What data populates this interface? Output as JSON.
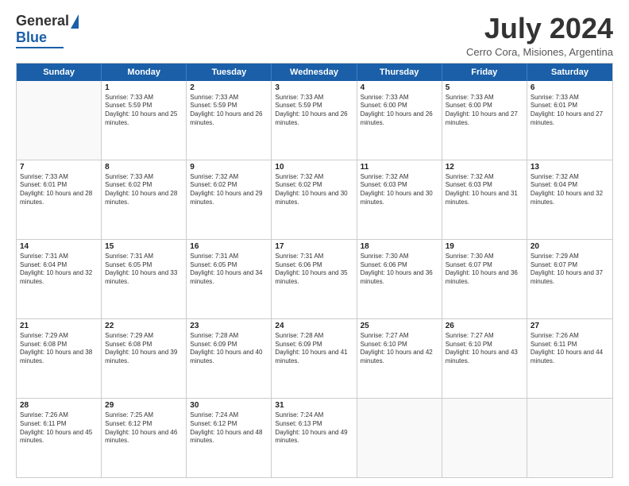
{
  "logo": {
    "general": "General",
    "blue": "Blue"
  },
  "title": "July 2024",
  "location": "Cerro Cora, Misiones, Argentina",
  "days_of_week": [
    "Sunday",
    "Monday",
    "Tuesday",
    "Wednesday",
    "Thursday",
    "Friday",
    "Saturday"
  ],
  "weeks": [
    [
      {
        "day": "",
        "sunrise": "",
        "sunset": "",
        "daylight": ""
      },
      {
        "day": "1",
        "sunrise": "Sunrise: 7:33 AM",
        "sunset": "Sunset: 5:59 PM",
        "daylight": "Daylight: 10 hours and 25 minutes."
      },
      {
        "day": "2",
        "sunrise": "Sunrise: 7:33 AM",
        "sunset": "Sunset: 5:59 PM",
        "daylight": "Daylight: 10 hours and 26 minutes."
      },
      {
        "day": "3",
        "sunrise": "Sunrise: 7:33 AM",
        "sunset": "Sunset: 5:59 PM",
        "daylight": "Daylight: 10 hours and 26 minutes."
      },
      {
        "day": "4",
        "sunrise": "Sunrise: 7:33 AM",
        "sunset": "Sunset: 6:00 PM",
        "daylight": "Daylight: 10 hours and 26 minutes."
      },
      {
        "day": "5",
        "sunrise": "Sunrise: 7:33 AM",
        "sunset": "Sunset: 6:00 PM",
        "daylight": "Daylight: 10 hours and 27 minutes."
      },
      {
        "day": "6",
        "sunrise": "Sunrise: 7:33 AM",
        "sunset": "Sunset: 6:01 PM",
        "daylight": "Daylight: 10 hours and 27 minutes."
      }
    ],
    [
      {
        "day": "7",
        "sunrise": "Sunrise: 7:33 AM",
        "sunset": "Sunset: 6:01 PM",
        "daylight": "Daylight: 10 hours and 28 minutes."
      },
      {
        "day": "8",
        "sunrise": "Sunrise: 7:33 AM",
        "sunset": "Sunset: 6:02 PM",
        "daylight": "Daylight: 10 hours and 28 minutes."
      },
      {
        "day": "9",
        "sunrise": "Sunrise: 7:32 AM",
        "sunset": "Sunset: 6:02 PM",
        "daylight": "Daylight: 10 hours and 29 minutes."
      },
      {
        "day": "10",
        "sunrise": "Sunrise: 7:32 AM",
        "sunset": "Sunset: 6:02 PM",
        "daylight": "Daylight: 10 hours and 30 minutes."
      },
      {
        "day": "11",
        "sunrise": "Sunrise: 7:32 AM",
        "sunset": "Sunset: 6:03 PM",
        "daylight": "Daylight: 10 hours and 30 minutes."
      },
      {
        "day": "12",
        "sunrise": "Sunrise: 7:32 AM",
        "sunset": "Sunset: 6:03 PM",
        "daylight": "Daylight: 10 hours and 31 minutes."
      },
      {
        "day": "13",
        "sunrise": "Sunrise: 7:32 AM",
        "sunset": "Sunset: 6:04 PM",
        "daylight": "Daylight: 10 hours and 32 minutes."
      }
    ],
    [
      {
        "day": "14",
        "sunrise": "Sunrise: 7:31 AM",
        "sunset": "Sunset: 6:04 PM",
        "daylight": "Daylight: 10 hours and 32 minutes."
      },
      {
        "day": "15",
        "sunrise": "Sunrise: 7:31 AM",
        "sunset": "Sunset: 6:05 PM",
        "daylight": "Daylight: 10 hours and 33 minutes."
      },
      {
        "day": "16",
        "sunrise": "Sunrise: 7:31 AM",
        "sunset": "Sunset: 6:05 PM",
        "daylight": "Daylight: 10 hours and 34 minutes."
      },
      {
        "day": "17",
        "sunrise": "Sunrise: 7:31 AM",
        "sunset": "Sunset: 6:06 PM",
        "daylight": "Daylight: 10 hours and 35 minutes."
      },
      {
        "day": "18",
        "sunrise": "Sunrise: 7:30 AM",
        "sunset": "Sunset: 6:06 PM",
        "daylight": "Daylight: 10 hours and 36 minutes."
      },
      {
        "day": "19",
        "sunrise": "Sunrise: 7:30 AM",
        "sunset": "Sunset: 6:07 PM",
        "daylight": "Daylight: 10 hours and 36 minutes."
      },
      {
        "day": "20",
        "sunrise": "Sunrise: 7:29 AM",
        "sunset": "Sunset: 6:07 PM",
        "daylight": "Daylight: 10 hours and 37 minutes."
      }
    ],
    [
      {
        "day": "21",
        "sunrise": "Sunrise: 7:29 AM",
        "sunset": "Sunset: 6:08 PM",
        "daylight": "Daylight: 10 hours and 38 minutes."
      },
      {
        "day": "22",
        "sunrise": "Sunrise: 7:29 AM",
        "sunset": "Sunset: 6:08 PM",
        "daylight": "Daylight: 10 hours and 39 minutes."
      },
      {
        "day": "23",
        "sunrise": "Sunrise: 7:28 AM",
        "sunset": "Sunset: 6:09 PM",
        "daylight": "Daylight: 10 hours and 40 minutes."
      },
      {
        "day": "24",
        "sunrise": "Sunrise: 7:28 AM",
        "sunset": "Sunset: 6:09 PM",
        "daylight": "Daylight: 10 hours and 41 minutes."
      },
      {
        "day": "25",
        "sunrise": "Sunrise: 7:27 AM",
        "sunset": "Sunset: 6:10 PM",
        "daylight": "Daylight: 10 hours and 42 minutes."
      },
      {
        "day": "26",
        "sunrise": "Sunrise: 7:27 AM",
        "sunset": "Sunset: 6:10 PM",
        "daylight": "Daylight: 10 hours and 43 minutes."
      },
      {
        "day": "27",
        "sunrise": "Sunrise: 7:26 AM",
        "sunset": "Sunset: 6:11 PM",
        "daylight": "Daylight: 10 hours and 44 minutes."
      }
    ],
    [
      {
        "day": "28",
        "sunrise": "Sunrise: 7:26 AM",
        "sunset": "Sunset: 6:11 PM",
        "daylight": "Daylight: 10 hours and 45 minutes."
      },
      {
        "day": "29",
        "sunrise": "Sunrise: 7:25 AM",
        "sunset": "Sunset: 6:12 PM",
        "daylight": "Daylight: 10 hours and 46 minutes."
      },
      {
        "day": "30",
        "sunrise": "Sunrise: 7:24 AM",
        "sunset": "Sunset: 6:12 PM",
        "daylight": "Daylight: 10 hours and 48 minutes."
      },
      {
        "day": "31",
        "sunrise": "Sunrise: 7:24 AM",
        "sunset": "Sunset: 6:13 PM",
        "daylight": "Daylight: 10 hours and 49 minutes."
      },
      {
        "day": "",
        "sunrise": "",
        "sunset": "",
        "daylight": ""
      },
      {
        "day": "",
        "sunrise": "",
        "sunset": "",
        "daylight": ""
      },
      {
        "day": "",
        "sunrise": "",
        "sunset": "",
        "daylight": ""
      }
    ]
  ]
}
